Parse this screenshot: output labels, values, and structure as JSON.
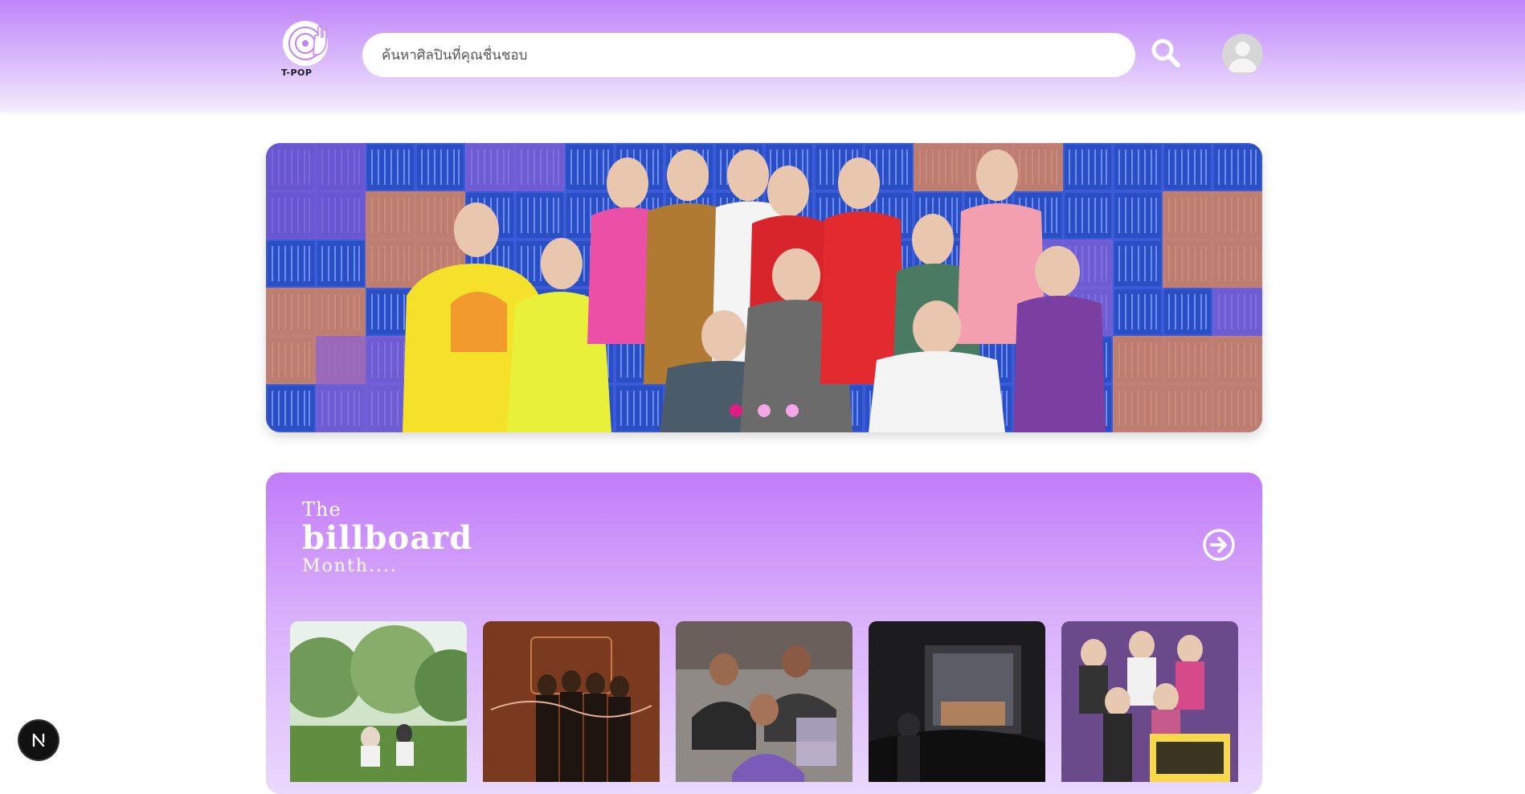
{
  "header": {
    "logo_text": "T-POP",
    "search_placeholder": "ค้นหาศิลปินที่คุณชื่นชอบ",
    "search_value": ""
  },
  "hero": {
    "slide_count": 3,
    "active_slide": 0
  },
  "billboard": {
    "title_line1": "The",
    "title_line2": "billboard",
    "title_line3": "Month....",
    "cards": [
      {
        "icon": "album-cover-garden-couple"
      },
      {
        "icon": "album-cover-band-brown"
      },
      {
        "icon": "album-cover-group-girls"
      },
      {
        "icon": "album-cover-dark-sunset"
      },
      {
        "icon": "album-cover-boyband-colorful"
      }
    ]
  },
  "colors": {
    "accent": "#c084fc",
    "dot_active": "#e11d84",
    "dot_inactive": "#f5a6e6"
  }
}
